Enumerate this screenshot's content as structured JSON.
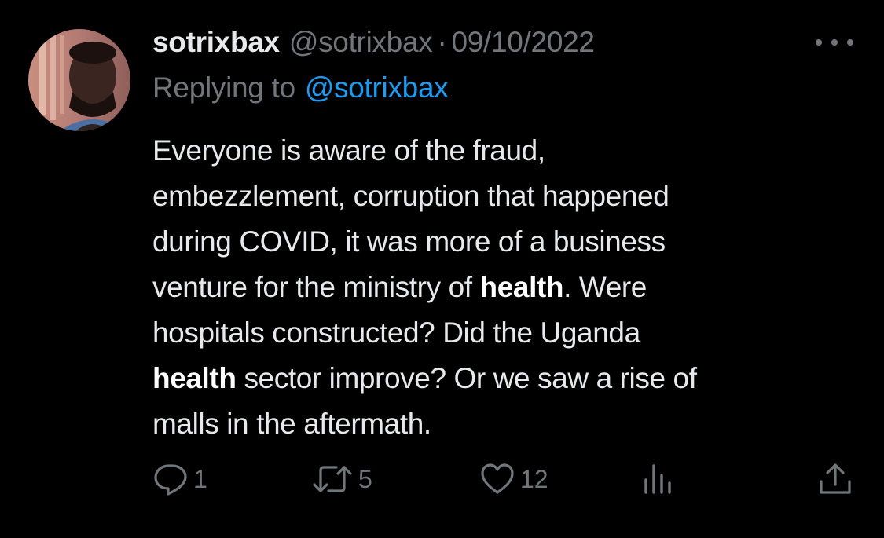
{
  "tweet": {
    "display_name": "sotrixbax",
    "handle": "@sotrixbax",
    "separator": "·",
    "date": "09/10/2022",
    "replying_label": "Replying to",
    "replying_to": "@sotrixbax",
    "body": {
      "line1": "Everyone is aware of the fraud,",
      "line2": "embezzlement, corruption that happened",
      "line3": "during COVID, it was more of a business",
      "line4_pre": "venture for the ministry of ",
      "line4_bold": "health",
      "line4_post": ". Were",
      "line5": "hospitals constructed? Did the Uganda",
      "line6_bold": "health",
      "line6_post": " sector improve? Or we saw a rise of",
      "line7": "malls in the aftermath."
    },
    "actions": {
      "replies": "1",
      "retweets": "5",
      "likes": "12"
    }
  },
  "icons": {
    "reply": "speech-bubble-icon",
    "retweet": "retweet-arrows-icon",
    "like": "heart-icon",
    "views": "bar-chart-icon",
    "share": "share-upload-icon",
    "more": "ellipsis-icon"
  },
  "colors": {
    "background": "#000000",
    "text_primary": "#e7e9ea",
    "text_secondary": "#71767b",
    "accent_link": "#1d9bf0"
  }
}
